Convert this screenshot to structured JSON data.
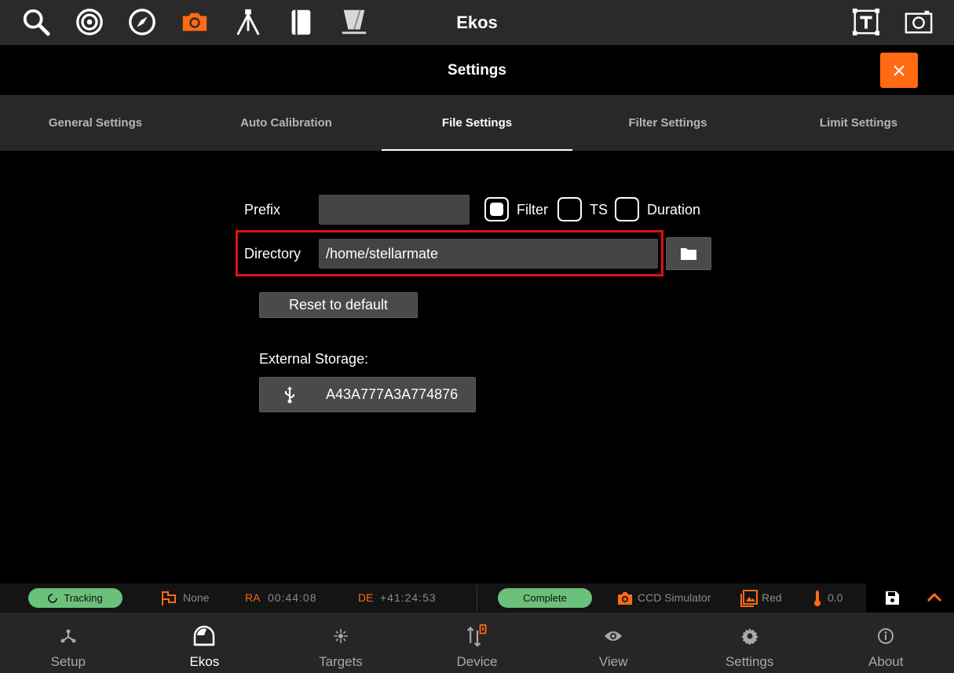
{
  "app": {
    "title": "Ekos"
  },
  "toolbar": {
    "left_icons": [
      "search-icon",
      "target-icon",
      "compass-icon",
      "camera-icon",
      "tripod-icon",
      "notebook-icon",
      "flat-panel-icon"
    ],
    "active_icon": "camera-icon",
    "right_icons": [
      "text-frame-icon",
      "screenshot-icon"
    ],
    "accent_color": "#ff6a13"
  },
  "settings": {
    "title": "Settings",
    "close_label": "✕"
  },
  "tabs": [
    {
      "label": "General Settings",
      "active": false
    },
    {
      "label": "Auto Calibration",
      "active": false
    },
    {
      "label": "File Settings",
      "active": true
    },
    {
      "label": "Filter Settings",
      "active": false
    },
    {
      "label": "Limit Settings",
      "active": false
    }
  ],
  "form": {
    "prefix_label": "Prefix",
    "prefix_value": "",
    "filter_label": "Filter",
    "filter_checked": true,
    "ts_label": "TS",
    "ts_checked": false,
    "duration_label": "Duration",
    "duration_checked": false,
    "directory_label": "Directory",
    "directory_value": "/home/stellarmate",
    "reset_label": "Reset to default",
    "external_storage_label": "External Storage:",
    "external_storage_device": "A43A777A3A774876"
  },
  "status": {
    "tracking": "Tracking",
    "target": "None",
    "ra_label": "RA",
    "ra_value": "00:44:08",
    "de_label": "DE",
    "de_value": "+41:24:53",
    "capture_status": "Complete",
    "camera": "CCD Simulator",
    "filter": "Red",
    "temperature": "0.0",
    "status_color": "#6bc07a"
  },
  "nav": [
    {
      "label": "Setup",
      "icon": "setup-icon",
      "active": false
    },
    {
      "label": "Ekos",
      "icon": "ekos-icon",
      "active": true
    },
    {
      "label": "Targets",
      "icon": "targets-icon",
      "active": false
    },
    {
      "label": "Device",
      "icon": "device-icon",
      "active": false
    },
    {
      "label": "View",
      "icon": "view-icon",
      "active": false
    },
    {
      "label": "Settings",
      "icon": "settings-icon",
      "active": false
    },
    {
      "label": "About",
      "icon": "about-icon",
      "active": false
    }
  ]
}
